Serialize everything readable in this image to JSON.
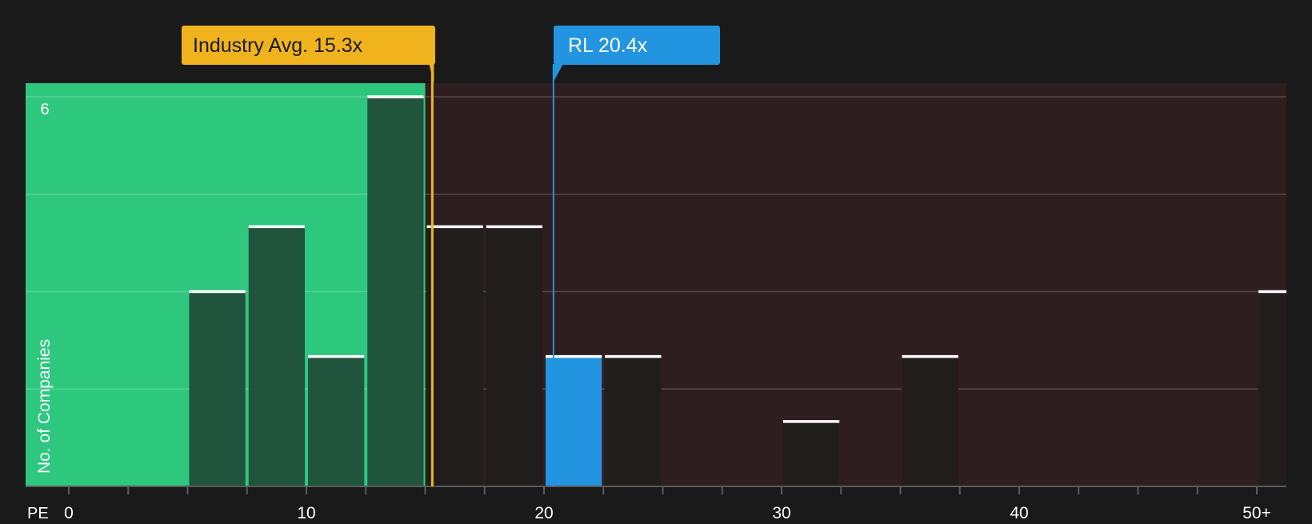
{
  "colors": {
    "background": "#1a1a1b",
    "good_zone": "#2ec77e",
    "bad_zone": "#2f1e1f",
    "bar_in_good_zone": "#1f4a36",
    "bar_in_bad_zone": "#221d1d",
    "highlight_bar": "#2394e0",
    "industry_marker": "#f0b31e",
    "company_marker": "#2394e0",
    "bar_cap": "#ffffff",
    "text": "#ffffff"
  },
  "chart_data": {
    "type": "bar",
    "xlabel": "PE",
    "ylabel": "No. of Companies",
    "xlim": [
      -2.5,
      50.5
    ],
    "ylim": [
      0,
      6.2
    ],
    "x_ticks": [
      0,
      10,
      20,
      30,
      40,
      50
    ],
    "x_tick_labels": [
      "0",
      "10",
      "20",
      "30",
      "40",
      "50+"
    ],
    "x_minor_tick_step": 2.5,
    "y_ticks": [
      0,
      1.5,
      3,
      4.5,
      6
    ],
    "y_tick_labels": [
      "",
      "",
      "",
      "",
      "6"
    ],
    "grid": true,
    "bars": [
      {
        "x_start": 5,
        "x_end": 7.5,
        "value": 3
      },
      {
        "x_start": 7.5,
        "x_end": 10,
        "value": 4
      },
      {
        "x_start": 10,
        "x_end": 12.5,
        "value": 2
      },
      {
        "x_start": 12.5,
        "x_end": 15,
        "value": 6
      },
      {
        "x_start": 15,
        "x_end": 17.5,
        "value": 4
      },
      {
        "x_start": 17.5,
        "x_end": 20,
        "value": 4
      },
      {
        "x_start": 20,
        "x_end": 22.5,
        "value": 2,
        "highlight": true
      },
      {
        "x_start": 22.5,
        "x_end": 25,
        "value": 2
      },
      {
        "x_start": 30,
        "x_end": 32.5,
        "value": 1
      },
      {
        "x_start": 35,
        "x_end": 37.5,
        "value": 2
      },
      {
        "x_start": 50,
        "x_end": 52.5,
        "value": 3
      }
    ],
    "good_zone_max": 15,
    "annotations": [
      {
        "id": "industry",
        "label": "Industry Avg. 15.3x",
        "x": 15.3
      },
      {
        "id": "company",
        "label": "RL 20.4x",
        "x": 20.4
      }
    ]
  }
}
